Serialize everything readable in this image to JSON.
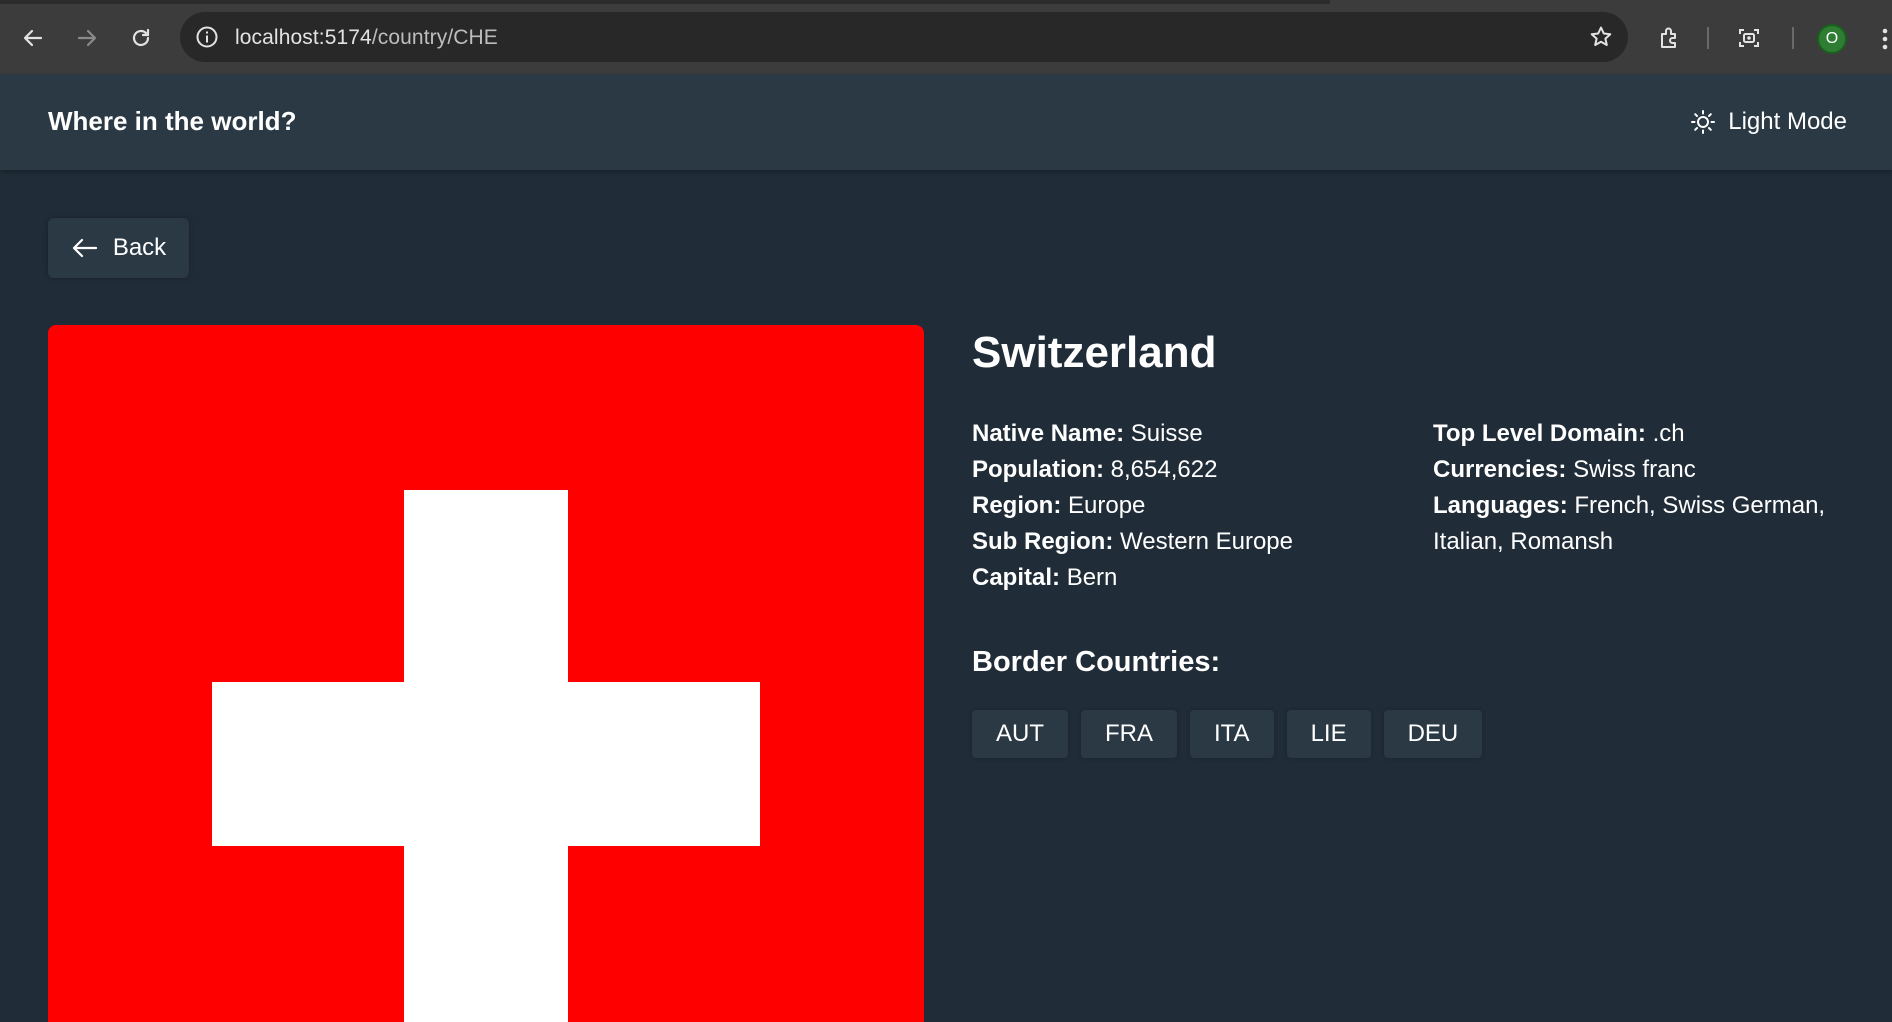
{
  "browser": {
    "url_host": "localhost:5174",
    "url_path": "/country/CHE",
    "profile_initial": "O",
    "icons": [
      "back-arrow-icon",
      "forward-arrow-icon",
      "reload-icon",
      "info-icon",
      "star-icon",
      "extensions-icon",
      "screenshot-icon",
      "menu-dots-icon"
    ]
  },
  "header": {
    "title": "Where in the world?",
    "mode_label": "Light Mode",
    "mode_icon": "sun-icon"
  },
  "back_button": {
    "label": "Back",
    "icon": "arrow-left-icon"
  },
  "flag": {
    "country": "Switzerland",
    "colors": {
      "field": "#ff0000",
      "cross": "#ffffff"
    }
  },
  "country": {
    "name": "Switzerland",
    "left": [
      {
        "label": "Native Name:",
        "value": "Suisse"
      },
      {
        "label": "Population:",
        "value": "8,654,622"
      },
      {
        "label": "Region:",
        "value": "Europe"
      },
      {
        "label": "Sub Region:",
        "value": "Western Europe"
      },
      {
        "label": "Capital:",
        "value": "Bern"
      }
    ],
    "right": [
      {
        "label": "Top Level Domain:",
        "value": ".ch"
      },
      {
        "label": "Currencies:",
        "value": "Swiss franc"
      },
      {
        "label": "Languages:",
        "value": "French, Swiss German, Italian, Romansh"
      }
    ],
    "border_title": "Border Countries:",
    "borders": [
      "AUT",
      "FRA",
      "ITA",
      "LIE",
      "DEU"
    ]
  },
  "colors": {
    "background": "#202c37",
    "element": "#2b3945",
    "text": "#ffffff"
  }
}
